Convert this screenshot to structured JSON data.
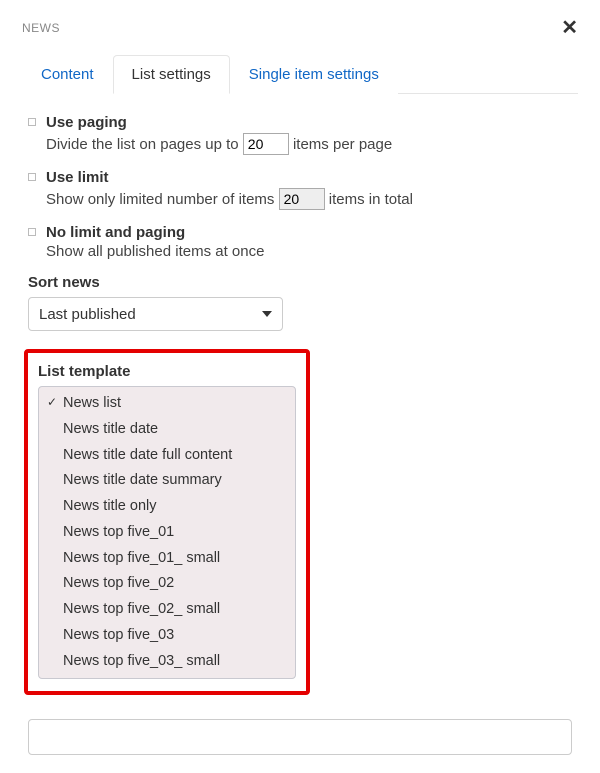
{
  "dialog": {
    "title": "NEWS"
  },
  "tabs": {
    "content": "Content",
    "list_settings": "List settings",
    "single_item": "Single item settings"
  },
  "options": {
    "paging": {
      "title": "Use paging",
      "desc_before": "Divide the list on pages up to",
      "value": "20",
      "desc_after": "items per page"
    },
    "limit": {
      "title": "Use limit",
      "desc_before": "Show only limited number of items",
      "value": "20",
      "desc_after": "items in total"
    },
    "nolimit": {
      "title": "No limit and paging",
      "desc": "Show all published items at once"
    }
  },
  "sort": {
    "label": "Sort news",
    "selected": "Last published"
  },
  "list_template": {
    "label": "List template",
    "options": [
      "News list",
      "News title date",
      "News title date full content",
      "News title date summary",
      "News title only",
      "News top five_01",
      "News top five_01_ small",
      "News top five_02",
      "News top five_02_ small",
      "News top five_03",
      "News top five_03_ small"
    ],
    "selected_index": 0
  }
}
